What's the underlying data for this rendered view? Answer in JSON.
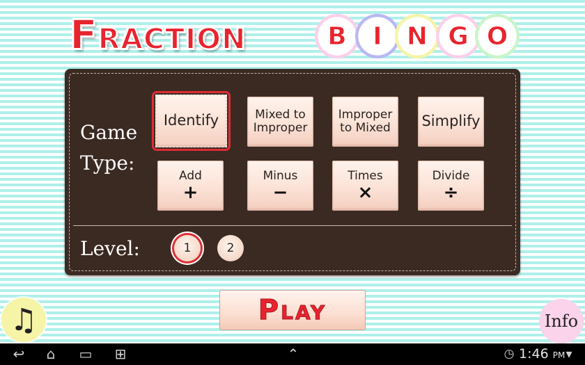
{
  "title": {
    "word1": "Fraction",
    "word2_letters": [
      {
        "letter": "B",
        "ring": "#fbd0ea"
      },
      {
        "letter": "I",
        "ring": "#b9b8f2"
      },
      {
        "letter": "N",
        "ring": "#f6f4a6"
      },
      {
        "letter": "G",
        "ring": "#fbd0ea"
      },
      {
        "letter": "O",
        "ring": "#c9f5c8"
      }
    ]
  },
  "panel": {
    "game_type_label": "Game\nType:",
    "level_label": "Level:",
    "game_types": [
      {
        "label": "Identify",
        "selected": true,
        "symbol": ""
      },
      {
        "label": "Mixed to\nImproper",
        "selected": false,
        "symbol": ""
      },
      {
        "label": "Improper\nto Mixed",
        "selected": false,
        "symbol": ""
      },
      {
        "label": "Simplify",
        "selected": false,
        "symbol": ""
      },
      {
        "label": "Add",
        "selected": false,
        "symbol": "+"
      },
      {
        "label": "Minus",
        "selected": false,
        "symbol": "−"
      },
      {
        "label": "Times",
        "selected": false,
        "symbol": "×"
      },
      {
        "label": "Divide",
        "selected": false,
        "symbol": "÷"
      }
    ],
    "levels": [
      {
        "label": "1",
        "selected": true
      },
      {
        "label": "2",
        "selected": false
      }
    ]
  },
  "play_label": "Play",
  "music_icon": "♫",
  "info_label": "Info",
  "navbar": {
    "back_icon": "↩",
    "home_icon": "⌂",
    "recents_icon": "▭",
    "screenshot_icon": "⊞",
    "up_icon": "⌃",
    "time": "1:46",
    "ampm": "PM",
    "signal_icon": "▾",
    "alarm_icon": "◷"
  },
  "colors": {
    "accent_red": "#e8242e",
    "panel_brown": "#3b2a22",
    "stripe_cyan": "#aef0ea"
  }
}
